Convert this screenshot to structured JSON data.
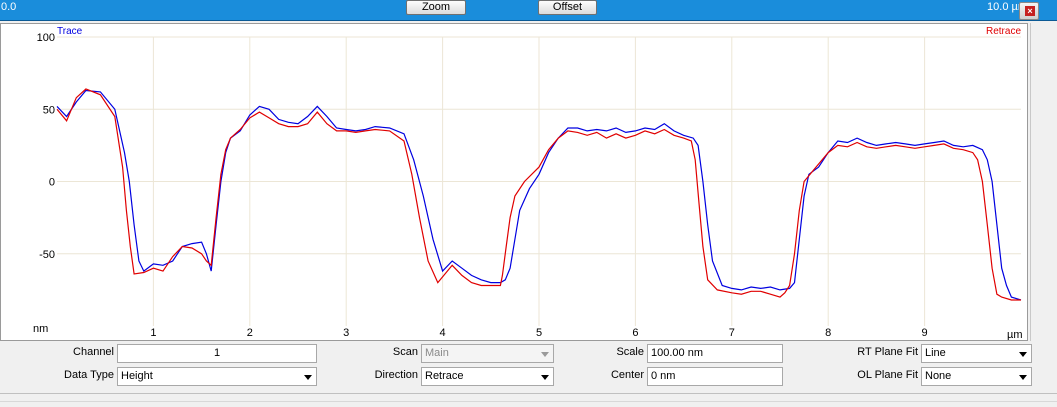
{
  "toolbar": {
    "left_value": "0.0",
    "zoom_label": "Zoom",
    "offset_label": "Offset",
    "right_value": "10.0 µm"
  },
  "colors": {
    "trace": "#0000e0",
    "retrace": "#e00000",
    "toolbar": "#1a8ddb",
    "grid": "#ece6d6"
  },
  "plot": {
    "trace_label": "Trace",
    "retrace_label": "Retrace",
    "y_unit": "nm",
    "x_unit": "µm"
  },
  "chart_data": {
    "type": "line",
    "xlabel": "µm",
    "ylabel": "nm",
    "xlim": [
      0,
      10
    ],
    "ylim": [
      -100,
      100
    ],
    "x_ticks": [
      "1",
      "2",
      "3",
      "4",
      "5",
      "6",
      "7",
      "8",
      "9"
    ],
    "y_ticks": [
      "100",
      "50",
      "0",
      "-50"
    ],
    "legend": "top-left / top-right",
    "series": [
      {
        "name": "Trace",
        "color": "#0000e0",
        "x": [
          0,
          0.1,
          0.2,
          0.3,
          0.45,
          0.6,
          0.7,
          0.75,
          0.8,
          0.85,
          0.9,
          1.0,
          1.1,
          1.2,
          1.3,
          1.4,
          1.5,
          1.55,
          1.6,
          1.65,
          1.7,
          1.75,
          1.8,
          1.9,
          2.0,
          2.1,
          2.2,
          2.3,
          2.4,
          2.5,
          2.6,
          2.7,
          2.8,
          2.9,
          3.0,
          3.1,
          3.2,
          3.3,
          3.45,
          3.6,
          3.7,
          3.8,
          3.9,
          4.0,
          4.1,
          4.2,
          4.3,
          4.4,
          4.5,
          4.6,
          4.65,
          4.7,
          4.75,
          4.8,
          4.9,
          5.0,
          5.1,
          5.2,
          5.3,
          5.4,
          5.5,
          5.6,
          5.7,
          5.8,
          5.9,
          6.0,
          6.1,
          6.2,
          6.3,
          6.4,
          6.5,
          6.6,
          6.65,
          6.7,
          6.75,
          6.8,
          6.9,
          7.0,
          7.1,
          7.2,
          7.3,
          7.4,
          7.5,
          7.6,
          7.65,
          7.7,
          7.75,
          7.8,
          7.9,
          8.0,
          8.1,
          8.2,
          8.3,
          8.4,
          8.5,
          8.6,
          8.7,
          8.8,
          8.9,
          9.0,
          9.1,
          9.2,
          9.3,
          9.4,
          9.5,
          9.6,
          9.65,
          9.7,
          9.75,
          9.8,
          9.85,
          9.9,
          10.0
        ],
        "y": [
          52,
          45,
          55,
          63,
          62,
          50,
          20,
          0,
          -30,
          -55,
          -62,
          -57,
          -58,
          -55,
          -45,
          -43,
          -42,
          -50,
          -62,
          -30,
          0,
          20,
          30,
          35,
          46,
          52,
          50,
          43,
          41,
          40,
          45,
          52,
          45,
          37,
          36,
          35,
          36,
          38,
          37,
          33,
          15,
          -10,
          -40,
          -62,
          -55,
          -60,
          -65,
          -68,
          -70,
          -70,
          -68,
          -60,
          -40,
          -20,
          -5,
          5,
          20,
          30,
          37,
          37,
          35,
          36,
          35,
          37,
          34,
          35,
          37,
          36,
          40,
          35,
          32,
          30,
          25,
          0,
          -30,
          -55,
          -72,
          -74,
          -75,
          -73,
          -74,
          -73,
          -75,
          -74,
          -70,
          -40,
          -10,
          5,
          10,
          20,
          28,
          27,
          30,
          27,
          25,
          26,
          27,
          26,
          25,
          26,
          27,
          28,
          25,
          24,
          25,
          22,
          15,
          0,
          -30,
          -60,
          -72,
          -80,
          -82
        ]
      },
      {
        "name": "Retrace",
        "color": "#e00000",
        "x": [
          0,
          0.1,
          0.2,
          0.3,
          0.45,
          0.6,
          0.68,
          0.72,
          0.76,
          0.8,
          0.9,
          1.0,
          1.1,
          1.2,
          1.3,
          1.4,
          1.5,
          1.55,
          1.6,
          1.65,
          1.7,
          1.75,
          1.8,
          1.9,
          2.0,
          2.1,
          2.2,
          2.3,
          2.4,
          2.5,
          2.6,
          2.7,
          2.8,
          2.9,
          3.0,
          3.1,
          3.2,
          3.3,
          3.45,
          3.6,
          3.68,
          3.76,
          3.85,
          3.95,
          4.1,
          4.2,
          4.3,
          4.4,
          4.5,
          4.6,
          4.62,
          4.66,
          4.7,
          4.75,
          4.85,
          5.0,
          5.1,
          5.2,
          5.3,
          5.4,
          5.5,
          5.6,
          5.7,
          5.8,
          5.9,
          6.0,
          6.1,
          6.2,
          6.3,
          6.4,
          6.5,
          6.58,
          6.62,
          6.66,
          6.7,
          6.75,
          6.85,
          7.0,
          7.1,
          7.2,
          7.3,
          7.4,
          7.5,
          7.55,
          7.6,
          7.65,
          7.7,
          7.75,
          7.85,
          8.0,
          8.1,
          8.2,
          8.3,
          8.4,
          8.5,
          8.6,
          8.7,
          8.8,
          8.9,
          9.0,
          9.1,
          9.2,
          9.3,
          9.4,
          9.5,
          9.55,
          9.6,
          9.65,
          9.7,
          9.75,
          9.8,
          9.9,
          10.0
        ],
        "y": [
          50,
          42,
          58,
          64,
          60,
          45,
          10,
          -20,
          -45,
          -64,
          -63,
          -60,
          -62,
          -52,
          -45,
          -46,
          -50,
          -55,
          -58,
          -25,
          5,
          22,
          30,
          36,
          44,
          48,
          44,
          40,
          38,
          38,
          40,
          48,
          40,
          35,
          35,
          34,
          35,
          36,
          35,
          28,
          5,
          -25,
          -55,
          -70,
          -58,
          -65,
          -70,
          -72,
          -72,
          -72,
          -65,
          -45,
          -25,
          -10,
          0,
          10,
          22,
          30,
          35,
          34,
          32,
          34,
          30,
          33,
          30,
          32,
          35,
          33,
          36,
          32,
          30,
          28,
          15,
          -15,
          -45,
          -68,
          -75,
          -77,
          -78,
          -76,
          -76,
          -78,
          -80,
          -77,
          -72,
          -50,
          -20,
          0,
          8,
          20,
          25,
          24,
          27,
          24,
          23,
          24,
          25,
          24,
          23,
          24,
          25,
          26,
          23,
          22,
          20,
          15,
          0,
          -30,
          -60,
          -78,
          -80,
          -82,
          -82
        ]
      }
    ]
  },
  "controls": {
    "channel_label": "Channel",
    "channel_value": "1",
    "data_type_label": "Data Type",
    "data_type_value": "Height",
    "scan_label": "Scan",
    "scan_value": "Main",
    "direction_label": "Direction",
    "direction_value": "Retrace",
    "scale_label": "Scale",
    "scale_value": "100.00 nm",
    "center_label": "Center",
    "center_value": "0 nm",
    "rt_plane_fit_label": "RT Plane Fit",
    "rt_plane_fit_value": "Line",
    "ol_plane_fit_label": "OL Plane Fit",
    "ol_plane_fit_value": "None"
  }
}
